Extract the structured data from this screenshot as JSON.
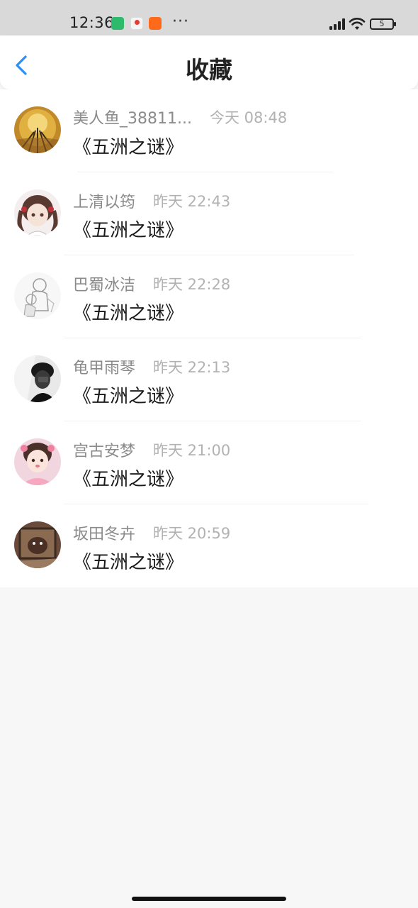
{
  "status_bar": {
    "time": "12:36",
    "more": "···",
    "battery": "5"
  },
  "header": {
    "title": "收藏",
    "back_icon": "chevron-left-icon"
  },
  "favorites": [
    {
      "user": "美人鱼_38811...",
      "time": "今天 08:48",
      "book": "《五洲之谜》"
    },
    {
      "user": "上清以筠",
      "time": "昨天 22:43",
      "book": "《五洲之谜》"
    },
    {
      "user": "巴蜀冰洁",
      "time": "昨天 22:28",
      "book": "《五洲之谜》"
    },
    {
      "user": "龟甲雨琴",
      "time": "昨天 22:13",
      "book": "《五洲之谜》"
    },
    {
      "user": "宫古安梦",
      "time": "昨天 21:00",
      "book": "《五洲之谜》"
    },
    {
      "user": "坂田冬卉",
      "time": "昨天 20:59",
      "book": "《五洲之谜》"
    }
  ],
  "colors": {
    "accent": "#2a8ff7",
    "title": "#222222",
    "username": "#8a8a8a",
    "timestamp": "#b2b2b2"
  }
}
